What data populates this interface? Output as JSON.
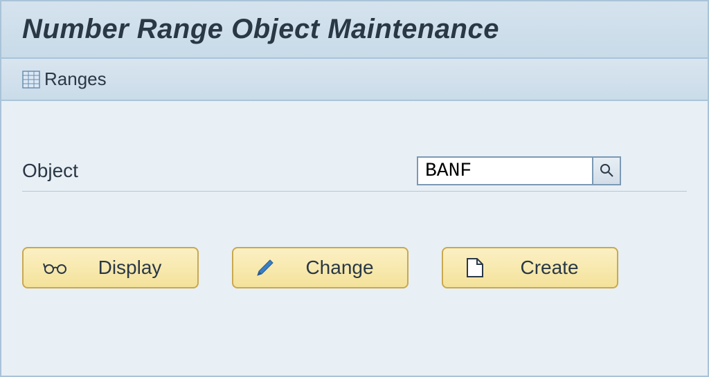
{
  "window": {
    "title": "Number Range Object Maintenance"
  },
  "toolbar": {
    "ranges_label": "Ranges"
  },
  "form": {
    "object_label": "Object",
    "object_value": "BANF"
  },
  "buttons": {
    "display": "Display",
    "change": "Change",
    "create": "Create"
  }
}
